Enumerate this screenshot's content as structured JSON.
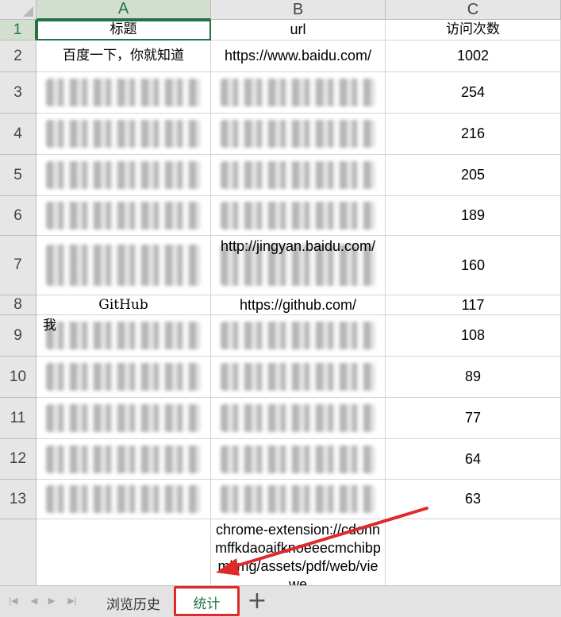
{
  "columns": [
    "A",
    "B",
    "C"
  ],
  "active_column": "A",
  "rows": [
    {
      "num": "1",
      "title": "标题",
      "url": "url",
      "visits": "访问次数",
      "blurred": false
    },
    {
      "num": "2",
      "title": "百度一下，你就知道",
      "url": "https://www.baidu.com/",
      "visits": "1002",
      "blurred": false
    },
    {
      "num": "3",
      "title": "",
      "url": "",
      "visits": "254",
      "blurred": true
    },
    {
      "num": "4",
      "title": "",
      "url": "",
      "visits": "216",
      "blurred": true
    },
    {
      "num": "5",
      "title": "",
      "url": "",
      "visits": "205",
      "blurred": true
    },
    {
      "num": "6",
      "title": "",
      "url": "",
      "visits": "189",
      "blurred": true
    },
    {
      "num": "7",
      "title": "",
      "url": "http://jingyan.baidu.com/",
      "visits": "160",
      "blurred": true
    },
    {
      "num": "8",
      "title": "GitHub",
      "url": "https://github.com/",
      "visits": "117",
      "blurred": false
    },
    {
      "num": "9",
      "title": "我",
      "url": "",
      "visits": "108",
      "blurred": true
    },
    {
      "num": "10",
      "title": "",
      "url": "",
      "visits": "89",
      "blurred": true
    },
    {
      "num": "11",
      "title": "",
      "url": "",
      "visits": "77",
      "blurred": true
    },
    {
      "num": "12",
      "title": "",
      "url": "",
      "visits": "64",
      "blurred": true
    },
    {
      "num": "13",
      "title": "",
      "url": "",
      "visits": "63",
      "blurred": true
    },
    {
      "num": "",
      "title": "",
      "url": "chrome-extension://cdonnmffkdaoajfknoeeecmchibpmkmg/assets/pdf/web/viewe",
      "visits": "",
      "blurred": false
    }
  ],
  "tabs": [
    {
      "label": "浏览历史",
      "active": false
    },
    {
      "label": "统计",
      "active": true
    }
  ],
  "add_tab_symbol": "+",
  "nav_buttons": [
    "|◀",
    "◀",
    "▶",
    "▶|"
  ],
  "colors": {
    "accent": "#217346",
    "annotation": "#e02a2a",
    "header_bg": "#e6e6e6",
    "grid": "#d4d4d4"
  }
}
